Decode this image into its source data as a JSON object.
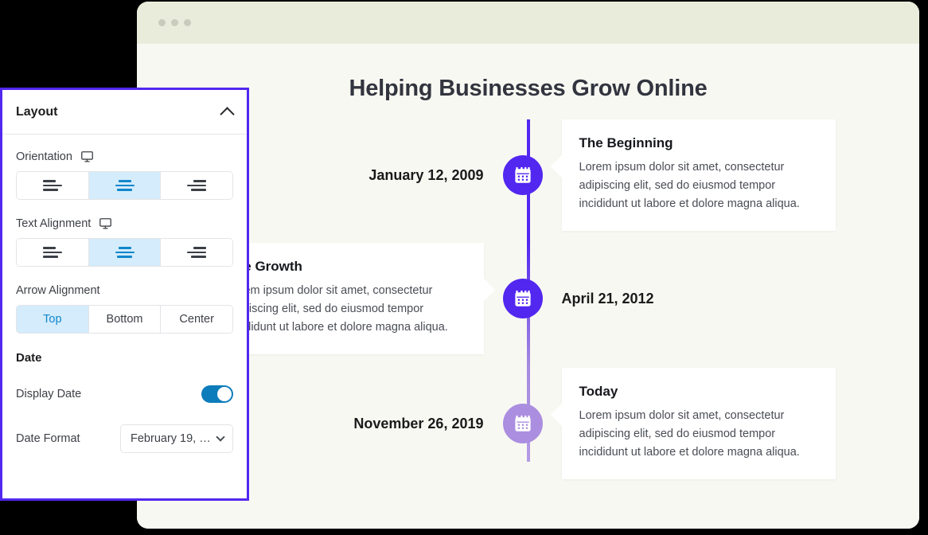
{
  "browser": {
    "dots": [
      "dot-1",
      "dot-2",
      "dot-3"
    ]
  },
  "page": {
    "title": "Helping Businesses Grow Online"
  },
  "timeline": {
    "accent_color": "#5227f0",
    "faded_color": "#ab8ee0",
    "items": [
      {
        "date": "January 12, 2009",
        "card_title": "The Beginning",
        "card_body": "Lorem ipsum dolor sit amet, consectetur adipiscing elit, sed do eiusmod tempor incididunt ut labore et dolore magna aliqua.",
        "side": "right",
        "marker_icon": "calendar-icon",
        "faded": false
      },
      {
        "date": "April 21, 2012",
        "card_title": "The Growth",
        "card_body": "Lorem ipsum dolor sit amet, consectetur adipiscing elit, sed do eiusmod tempor incididunt ut labore et dolore magna aliqua.",
        "side": "left",
        "marker_icon": "calendar-icon",
        "faded": false
      },
      {
        "date": "November 26, 2019",
        "card_title": "Today",
        "card_body": "Lorem ipsum dolor sit amet, consectetur adipiscing elit, sed do eiusmod tempor incididunt ut labore et dolore magna aliqua.",
        "side": "right",
        "marker_icon": "calendar-icon",
        "faded": true
      }
    ]
  },
  "panel": {
    "title": "Layout",
    "collapse_icon": "chevron-up-icon",
    "border_color": "#5227f0",
    "orientation": {
      "label": "Orientation",
      "device_icon": "monitor-icon",
      "options": [
        "align-left",
        "align-center",
        "align-right"
      ],
      "selected_index": 1
    },
    "text_alignment": {
      "label": "Text Alignment",
      "device_icon": "monitor-icon",
      "options": [
        "align-left",
        "align-center",
        "align-right"
      ],
      "selected_index": 1
    },
    "arrow_alignment": {
      "label": "Arrow Alignment",
      "options": [
        "Top",
        "Bottom",
        "Center"
      ],
      "selected_index": 0
    },
    "date_section": {
      "label": "Date",
      "display_date": {
        "label": "Display Date",
        "enabled": true,
        "color": "#0d7cba"
      },
      "date_format": {
        "label": "Date Format",
        "value": "February 19, …",
        "chevron_icon": "chevron-down-icon"
      }
    }
  }
}
